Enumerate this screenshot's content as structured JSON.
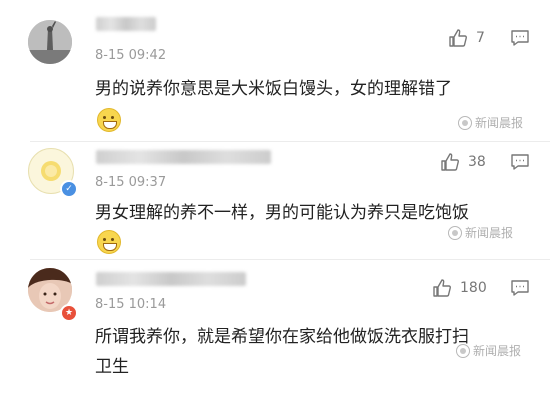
{
  "comments": [
    {
      "time": "8-15 09:42",
      "likes": "7",
      "text_lines": [
        "男的说养你意思是大米饭白馒头，女的理解错了"
      ],
      "emoji": "crying-laugh-emoji",
      "watermark": "新闻晨报"
    },
    {
      "time": "8-15 09:37",
      "likes": "38",
      "text_lines": [
        "男女理解的养不一样，男的可能认为养只是吃饱饭"
      ],
      "emoji": "grin-emoji",
      "watermark": "新闻晨报"
    },
    {
      "time": "8-15 10:14",
      "likes": "180",
      "text_lines": [
        "所谓我养你，就是希望你在家给他做饭洗衣服打扫",
        "卫生"
      ],
      "watermark": "新闻晨报"
    }
  ],
  "icons": {
    "like": "thumbs-up-icon",
    "reply": "comment-bubble-icon",
    "verified": "verified-badge-icon"
  }
}
